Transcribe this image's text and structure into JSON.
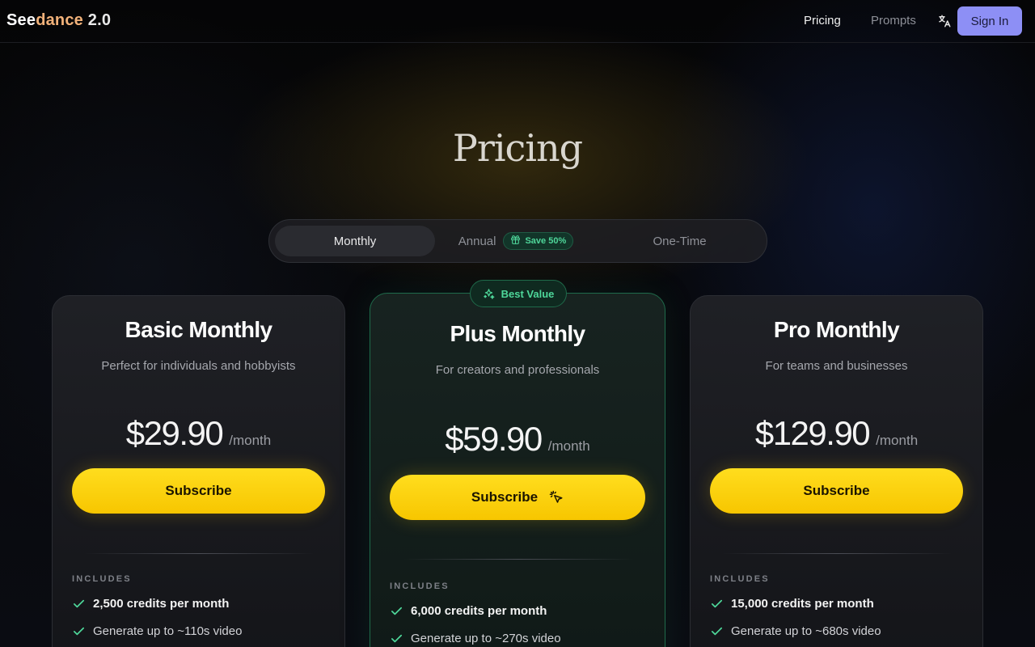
{
  "brand": {
    "part1": "See",
    "part2": "dance",
    "part3": " 2.0"
  },
  "nav": {
    "links": [
      {
        "label": "Pricing",
        "active": true
      },
      {
        "label": "Prompts",
        "active": false
      }
    ],
    "language_icon": "translate-icon",
    "signin_label": "Sign In"
  },
  "page": {
    "title": "Pricing"
  },
  "billing_toggle": {
    "options": [
      {
        "label": "Monthly",
        "active": true
      },
      {
        "label": "Annual",
        "badge": "Save 50%",
        "badge_icon": "gift-icon"
      },
      {
        "label": "One-Time"
      }
    ]
  },
  "plans": [
    {
      "name": "Basic Monthly",
      "description": "Perfect for individuals and hobbyists",
      "price": "$29.90",
      "period": "/month",
      "cta": "Subscribe",
      "includes_label": "INCLUDES",
      "features": [
        "2,500 credits per month",
        "Generate up to ~110s video"
      ]
    },
    {
      "name": "Plus Monthly",
      "badge": "Best Value",
      "badge_icon": "sparkles-icon",
      "description": "For creators and professionals",
      "price": "$59.90",
      "period": "/month",
      "cta": "Subscribe",
      "includes_label": "INCLUDES",
      "features": [
        "6,000 credits per month",
        "Generate up to ~270s video"
      ]
    },
    {
      "name": "Pro Monthly",
      "description": "For teams and businesses",
      "price": "$129.90",
      "period": "/month",
      "cta": "Subscribe",
      "includes_label": "INCLUDES",
      "features": [
        "15,000 credits per month",
        "Generate up to ~680s video"
      ]
    }
  ],
  "colors": {
    "accent_yellow": "#ffd60a",
    "signin_button": "#8d8ff5",
    "highlight_green": "#4ed79a",
    "brand_orange": "#f2b27a"
  }
}
